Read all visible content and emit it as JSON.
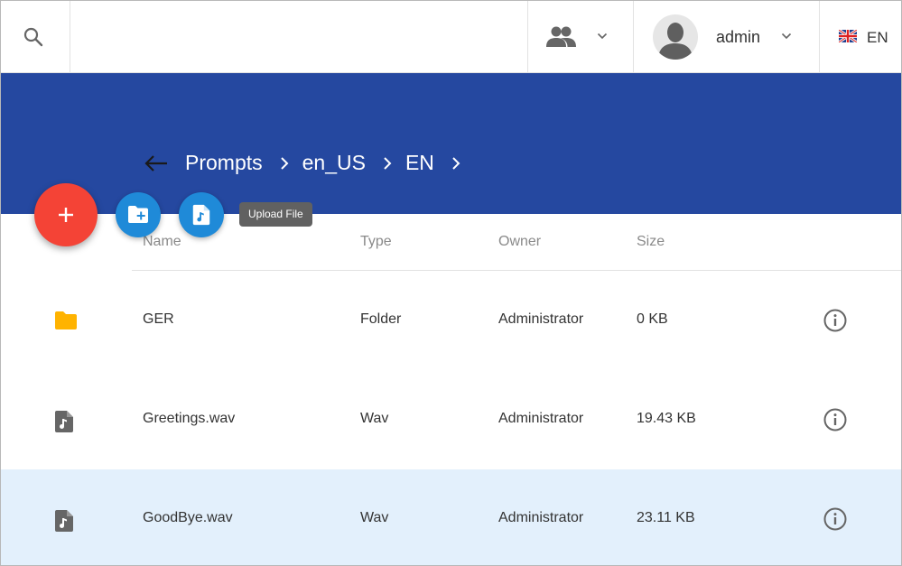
{
  "topbar": {
    "username": "admin",
    "language": "EN"
  },
  "breadcrumb": {
    "items": [
      "Prompts",
      "en_US",
      "EN"
    ]
  },
  "fab": {
    "tooltip": "Upload File"
  },
  "table": {
    "columns": [
      "Name",
      "Type",
      "Owner",
      "Size"
    ],
    "rows": [
      {
        "name": "GER",
        "type": "Folder",
        "owner": "Administrator",
        "size": "0 KB",
        "icon": "folder-icon",
        "selected": false
      },
      {
        "name": "Greetings.wav",
        "type": "Wav",
        "owner": "Administrator",
        "size": "19.43 KB",
        "icon": "audio-file-icon",
        "selected": false
      },
      {
        "name": "GoodBye.wav",
        "type": "Wav",
        "owner": "Administrator",
        "size": "23.11 KB",
        "icon": "audio-file-icon",
        "selected": true
      }
    ]
  },
  "colors": {
    "header_blue": "#2548a0",
    "fab_red": "#f44336",
    "fab_blue": "#1f8ad8",
    "folder_yellow": "#ffb300",
    "selected_row": "#e3f0fc"
  }
}
